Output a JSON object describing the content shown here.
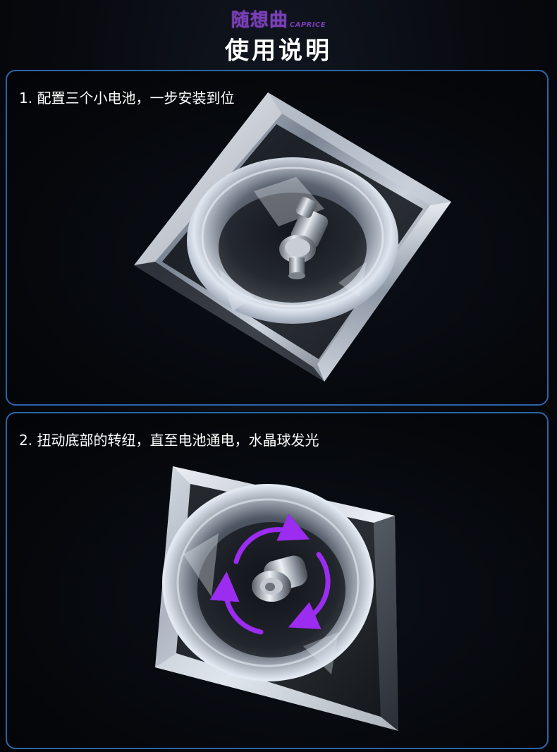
{
  "header": {
    "brand_cn": "随想曲",
    "brand_en": "CAPRICE",
    "title": "使用说明"
  },
  "steps": [
    {
      "label": "1. 配置三个小电池，一步安装到位",
      "image": "crystal-ball-base-battery-photo"
    },
    {
      "label": "2. 扭动底部的转纽，直至电池通电，水晶球发光",
      "image": "crystal-ball-base-knob-photo"
    }
  ],
  "colors": {
    "brand": "#7b3fb8",
    "panel_border": "#2a66a8",
    "rotation_arrows": "#9b2cf0",
    "background": "#05070c"
  },
  "icons": {
    "rotation": "rotate-arrows-icon"
  }
}
